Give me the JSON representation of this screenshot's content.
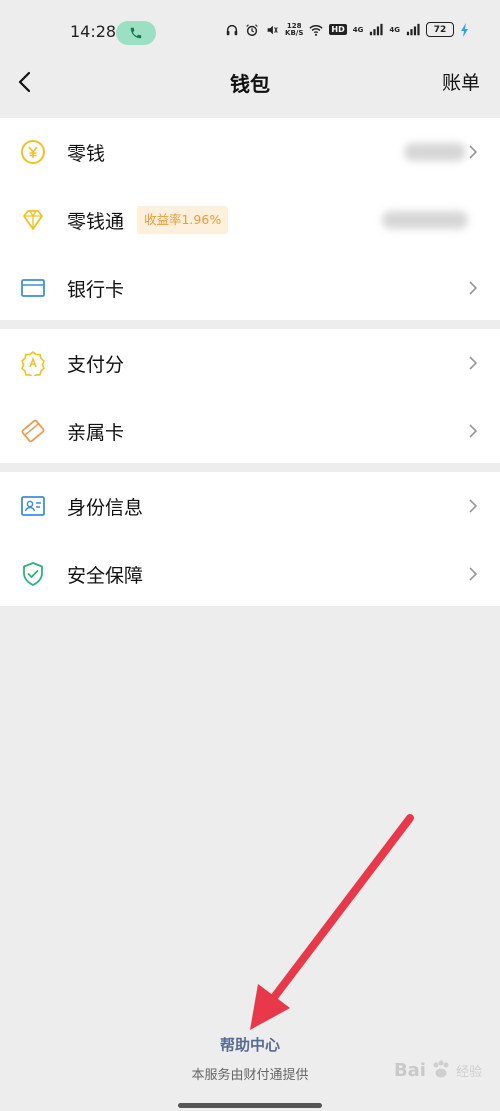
{
  "status_bar": {
    "time": "14:28",
    "net_speed_top": "128",
    "net_speed_bottom": "KB/S",
    "hd": "HD",
    "signal1": "4G",
    "signal2": "4G",
    "battery": "72"
  },
  "nav": {
    "title": "钱包",
    "right": "账单"
  },
  "groups": {
    "g1": [
      {
        "label": "零钱",
        "icon": "yuan-coin-icon",
        "color": "#f3c122"
      },
      {
        "label": "零钱通",
        "icon": "diamond-icon",
        "color": "#f3c122",
        "badge": "收益率1.96%"
      },
      {
        "label": "银行卡",
        "icon": "bank-card-icon",
        "color": "#3e8ee0"
      }
    ],
    "g2": [
      {
        "label": "支付分",
        "icon": "score-badge-icon",
        "color": "#f3c122"
      },
      {
        "label": "亲属卡",
        "icon": "family-card-icon",
        "color": "#ef9c52"
      }
    ],
    "g3": [
      {
        "label": "身份信息",
        "icon": "id-card-icon",
        "color": "#3e8ee0"
      },
      {
        "label": "安全保障",
        "icon": "shield-check-icon",
        "color": "#2fb27a"
      }
    ]
  },
  "footer": {
    "help": "帮助中心",
    "provider": "本服务由财付通提供"
  },
  "colors": {
    "background": "#ededed",
    "annotation_arrow": "#e8394b",
    "link": "#586b93"
  },
  "watermark": {
    "brand": "Bai",
    "suffix": "经验"
  }
}
